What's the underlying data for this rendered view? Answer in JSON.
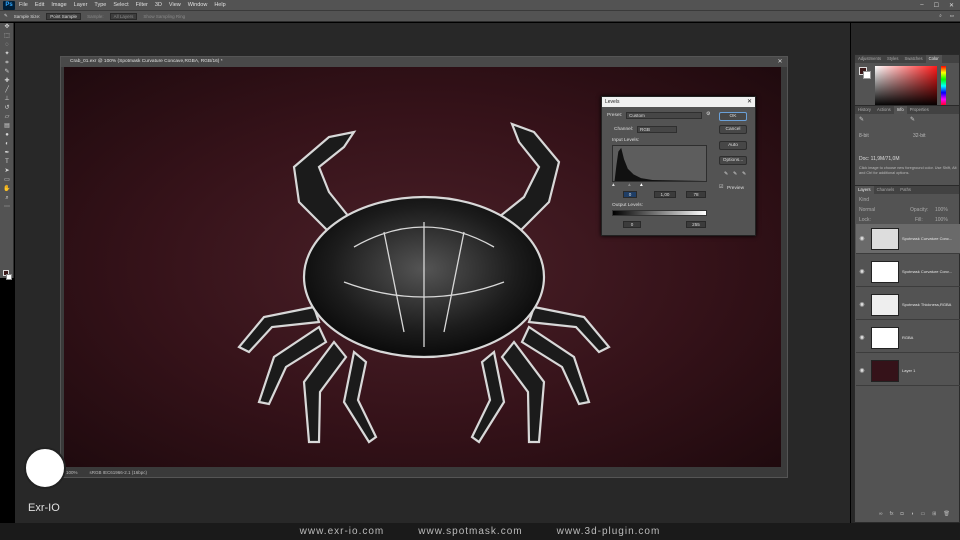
{
  "app": {
    "logo": "Ps",
    "menus": [
      "File",
      "Edit",
      "Image",
      "Layer",
      "Type",
      "Select",
      "Filter",
      "3D",
      "View",
      "Window",
      "Help"
    ],
    "window_controls": [
      "minimize-icon",
      "maximize-icon",
      "close-icon"
    ]
  },
  "options": {
    "sample_size_label": "Sample Size:",
    "sample_size_value": "Point Sample",
    "sample_label": "Sample:",
    "sample_value": "All Layers",
    "show_ring": "Show Sampling Ring"
  },
  "document": {
    "tab_title": "Crab_01.exr @ 100% (Spotmask Curvature Concave,RGBA, RGB/16) *",
    "status_zoom": "100%",
    "status_profile": "sRGB IEC61966-2.1 (16bpc)"
  },
  "levels": {
    "title": "Levels",
    "preset_label": "Preset:",
    "preset_value": "Custom",
    "channel_label": "Channel:",
    "channel_value": "RGB",
    "input_label": "Input Levels:",
    "input_black": "0",
    "input_gamma": "1,00",
    "input_white": "78",
    "output_label": "Output Levels:",
    "output_black": "0",
    "output_white": "255",
    "ok": "OK",
    "cancel": "Cancel",
    "auto": "Auto",
    "options": "Options...",
    "preview": "Preview"
  },
  "panels": {
    "color_tabs": [
      "Adjustments",
      "Styles",
      "Swatches",
      "Color"
    ],
    "info_tabs": [
      "History",
      "Actions",
      "Info",
      "Properties"
    ],
    "info_doc": "Doc: 11,9M/71,0M",
    "info_hint": "Click image to choose new foreground color. Use Shift, Alt and Ctrl for additional options.",
    "info_rgb_l": "R:\nG:\nB:",
    "info_bit_l": "8-bit",
    "info_bit_r": "32-bit",
    "layers_tabs": [
      "Layers",
      "Channels",
      "Paths"
    ],
    "kind_label": "Kind",
    "mode_label": "Normal",
    "opacity_label": "Opacity:",
    "opacity_value": "100%",
    "lock_label": "Lock:",
    "fill_label": "Fill:",
    "fill_value": "100%"
  },
  "layers": [
    {
      "name": "Spotmask Curvature Conc...",
      "selected": true
    },
    {
      "name": "Spotmask Curvature Conv..."
    },
    {
      "name": "Spotmask Thickness,RGBA"
    },
    {
      "name": "RGBA"
    },
    {
      "name": "Layer 1"
    }
  ],
  "footer": [
    "www.exr-io.com",
    "www.spotmask.com",
    "www.3d-plugin.com"
  ],
  "brand": "Exr-IO",
  "colors": {
    "accent": "#31a8ff",
    "canvas_bg": "#351219",
    "fg_swatch": "#3c1a1a"
  }
}
